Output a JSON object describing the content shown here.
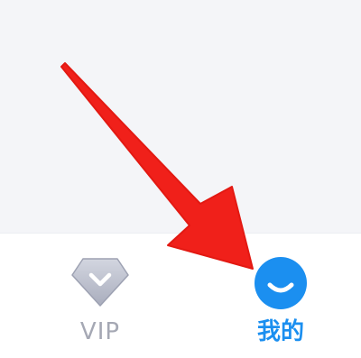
{
  "tab_bar": {
    "items": [
      {
        "label": "VIP",
        "icon": "vip-diamond-icon",
        "active": false
      },
      {
        "label": "我的",
        "icon": "smile-face-icon",
        "active": true
      }
    ]
  },
  "colors": {
    "active": "#1b8ff0",
    "inactive": "#a5a8b4",
    "annotation_arrow": "#f0201a"
  }
}
